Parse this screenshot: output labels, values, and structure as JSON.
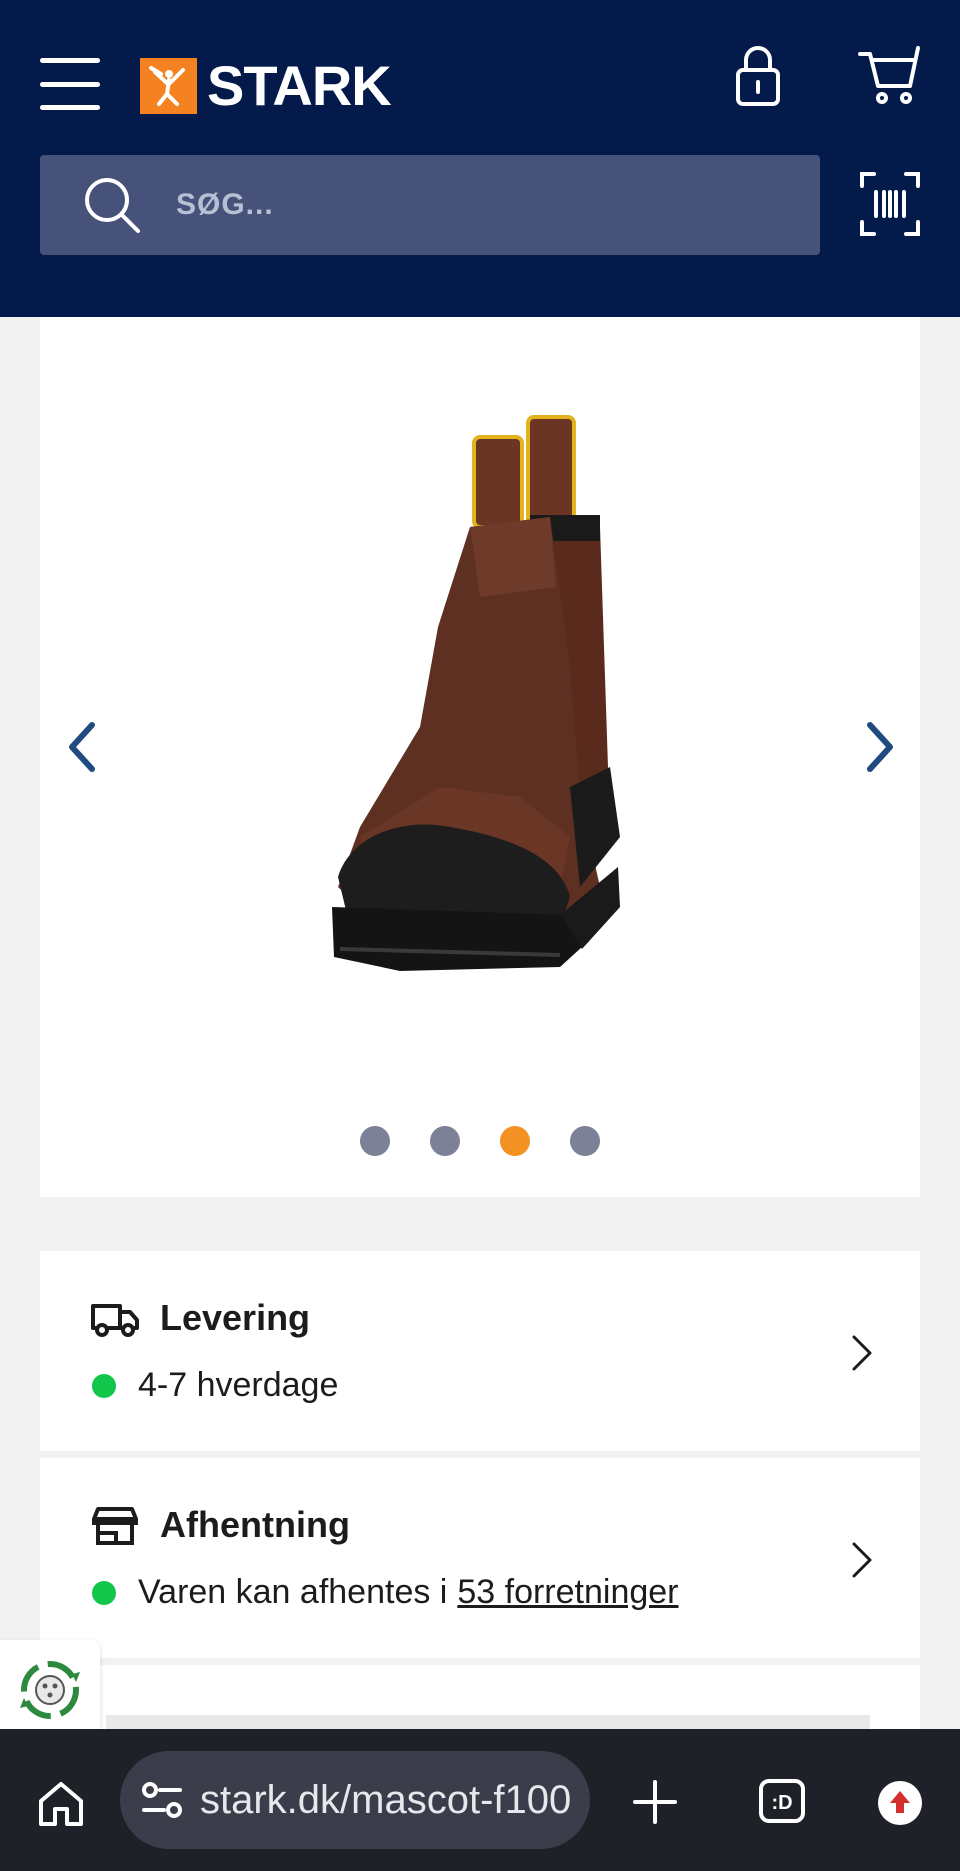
{
  "header": {
    "logo_text": "STARK",
    "brand_color": "#f58220",
    "background": "#031a4b"
  },
  "search": {
    "placeholder": "SØG..."
  },
  "gallery": {
    "image": "brown-chelsea-safety-boot",
    "slide_count": 4,
    "active_slide": 3,
    "active_color": "#f39222",
    "inactive_color": "#7c8198"
  },
  "delivery": {
    "title": "Levering",
    "status_text": "4-7 hverdage",
    "status_color": "#12c64b"
  },
  "pickup": {
    "title": "Afhentning",
    "status_prefix": "Varen kan afhentes i",
    "status_link": "53 forretninger",
    "status_color": "#12c64b"
  },
  "browser": {
    "url": "stark.dk/mascot-f100",
    "tabs_label": ":D"
  }
}
